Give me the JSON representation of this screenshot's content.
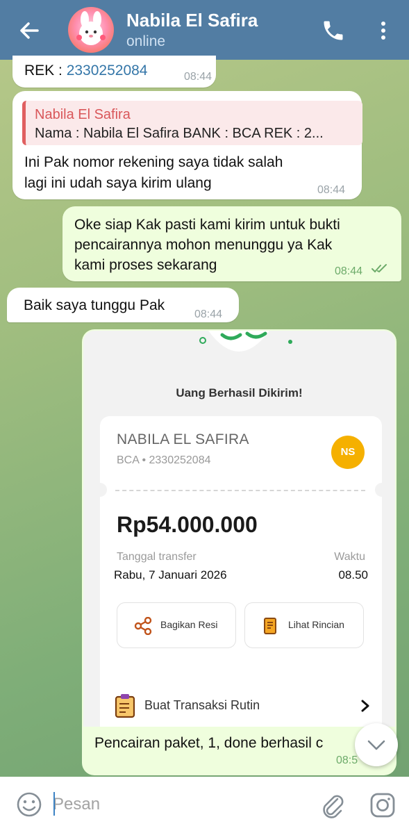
{
  "header": {
    "contact_name": "Nabila El Safira",
    "status": "online"
  },
  "messages": {
    "m1": {
      "prefix": "REK : ",
      "account": "2330252084",
      "time": "08:44"
    },
    "m2": {
      "quote_name": "Nabila El Safira",
      "quote_text": "Nama : Nabila El Safira BANK : BCA REK : 2...",
      "line1": "Ini Pak nomor rekening saya tidak salah",
      "line2": "lagi ini udah saya kirim ulang",
      "time": "08:44"
    },
    "m3": {
      "line1": "Oke siap Kak pasti kami kirim untuk bukti",
      "line2": "pencairannya mohon menunggu ya Kak",
      "line3": "kami proses sekarang",
      "time": "08:44"
    },
    "m4": {
      "text": "Baik saya tunggu Pak",
      "time": "08:44"
    },
    "m5": {
      "receipt": {
        "title": "Uang Berhasil Dikirim!",
        "recipient_name": "NABILA EL SAFIRA",
        "recipient_bank": "BCA • 2330252084",
        "badge": "NS",
        "amount": "Rp54.000.000",
        "date_label": "Tanggal transfer",
        "time_label": "Waktu",
        "date_value": "Rabu, 7 Januari 2026",
        "time_value": "08.50",
        "share_label": "Bagikan Resi",
        "detail_label": "Lihat Rincian",
        "routine_label": "Buat Transaksi Rutin"
      },
      "caption": "Pencairan paket, 1, done berhasil c",
      "time": "08:5"
    }
  },
  "input": {
    "placeholder": "Pesan"
  },
  "colors": {
    "header": "#527da3",
    "outgoing_bubble": "#effedd",
    "quote_accent": "#e05f60",
    "badge": "#f5b000"
  },
  "icons": [
    "back-arrow-icon",
    "phone-icon",
    "more-vert-icon",
    "double-check-icon",
    "share-icon",
    "document-icon",
    "clipboard-icon",
    "chevron-right-icon",
    "chevron-down-icon",
    "emoji-icon",
    "paperclip-icon",
    "camera-icon"
  ]
}
